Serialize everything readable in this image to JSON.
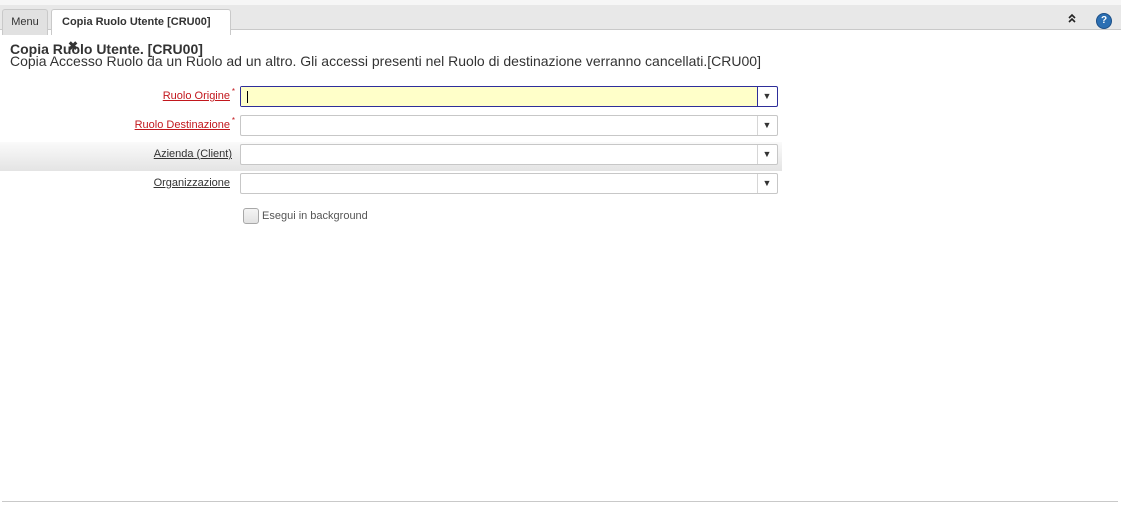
{
  "tabs": {
    "menu_label": "Menu",
    "active_label": "Copia Ruolo Utente [CRU00]",
    "close_glyph": "✖"
  },
  "toolbar": {
    "collapse_icon": "chevrons-up-icon",
    "collapse_glyph": "⌃",
    "help_icon": "help-icon",
    "help_glyph": "?"
  },
  "header": {
    "title": "Copia Ruolo Utente. [CRU00]",
    "description": "Copia Accesso Ruolo da un Ruolo ad un altro. Gli accessi presenti nel Ruolo di destinazione verranno cancellati.[CRU00]"
  },
  "fields": [
    {
      "label": "Ruolo Origine",
      "mandatory": true,
      "value": "",
      "focused": true
    },
    {
      "label": "Ruolo Destinazione",
      "mandatory": true,
      "value": "",
      "focused": false
    },
    {
      "label": "Azienda (Client)",
      "mandatory": false,
      "value": "",
      "focused": false
    },
    {
      "label": "Organizzazione",
      "mandatory": false,
      "value": "",
      "focused": false
    }
  ],
  "required_marker": "*",
  "dropdown_glyph": "▼",
  "background_option": {
    "label": "Esegui in background",
    "checked": false
  },
  "colors": {
    "mandatory_label": "#c2171d",
    "focused_input_bg": "#ffffc9",
    "focused_border": "#2e2e9a"
  }
}
